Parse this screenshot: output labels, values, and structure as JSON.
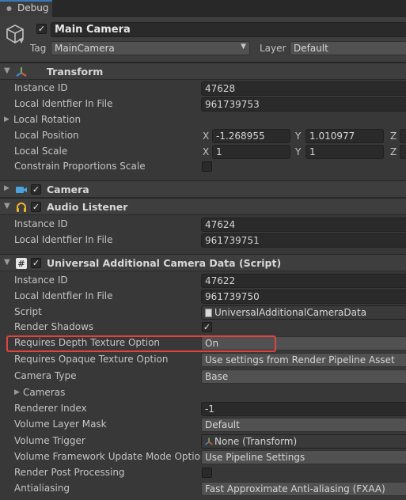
{
  "tab": {
    "label": "Debug"
  },
  "header": {
    "object_name": "Main Camera",
    "tag_label": "Tag",
    "tag_value": "MainCamera",
    "layer_label": "Layer",
    "layer_value": "Default"
  },
  "transform": {
    "title": "Transform",
    "instance_id_label": "Instance ID",
    "instance_id": "47628",
    "local_id_label": "Local Identfier In File",
    "local_id": "961739753",
    "local_rotation_label": "Local Rotation",
    "local_position_label": "Local Position",
    "pos_x": "-1.268955",
    "pos_y": "1.010977",
    "pos_z": "",
    "local_scale_label": "Local Scale",
    "scale_x": "1",
    "scale_y": "1",
    "scale_z": "",
    "constrain_label": "Constrain Proportions Scale",
    "axis_x": "X",
    "axis_y": "Y",
    "axis_z": "Z"
  },
  "camera": {
    "title": "Camera"
  },
  "audio_listener": {
    "title": "Audio Listener",
    "instance_id_label": "Instance ID",
    "instance_id": "47624",
    "local_id_label": "Local Identfier In File",
    "local_id": "961739751"
  },
  "uacd": {
    "title": "Universal Additional Camera Data (Script)",
    "instance_id_label": "Instance ID",
    "instance_id": "47622",
    "local_id_label": "Local Identfier In File",
    "local_id": "961739750",
    "script_label": "Script",
    "script_value": "UniversalAdditionalCameraData",
    "render_shadows_label": "Render Shadows",
    "depth_label": "Requires Depth Texture Option",
    "depth_value": "On",
    "opaque_label": "Requires Opaque Texture Option",
    "opaque_value": "Use settings from Render Pipeline Asset",
    "camera_type_label": "Camera Type",
    "camera_type_value": "Base",
    "cameras_label": "Cameras",
    "renderer_index_label": "Renderer Index",
    "renderer_index_value": "-1",
    "volume_mask_label": "Volume Layer Mask",
    "volume_mask_value": "Default",
    "volume_trigger_label": "Volume Trigger",
    "volume_trigger_value": "None (Transform)",
    "volume_fw_label": "Volume Framework Update Mode Option",
    "volume_fw_value": "Use Pipeline Settings",
    "render_post_label": "Render Post Processing",
    "antialiasing_label": "Antialiasing",
    "antialiasing_value": "Fast Approximate Anti-aliasing (FXAA)"
  },
  "colors": {
    "highlight": "#e0443e",
    "tab_accent": "#3a79bb"
  }
}
